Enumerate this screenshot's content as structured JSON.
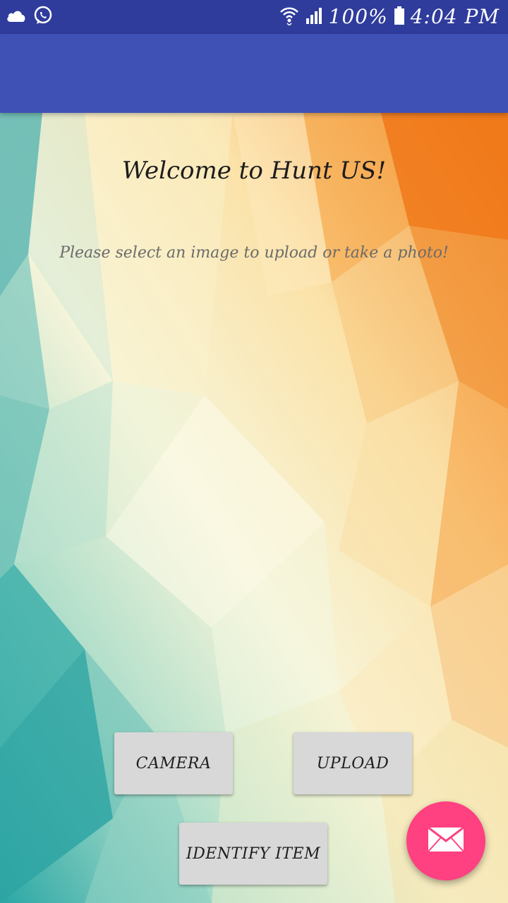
{
  "status_bar": {
    "left_icons": [
      "cloud-icon",
      "whatsapp-icon"
    ],
    "right_icons": [
      "wifi-icon",
      "signal-icon",
      "battery-icon"
    ],
    "battery": "100%",
    "time": "4:04 PM"
  },
  "app_bar": {
    "title": ""
  },
  "main": {
    "title": "Welcome to Hunt US!",
    "subtitle": "Please select an image to upload or take a photo!"
  },
  "buttons": {
    "camera": "CAMERA",
    "upload": "UPLOAD",
    "identify": "IDENTIFY ITEM"
  },
  "fab": {
    "icon": "mail-icon"
  },
  "colors": {
    "status_bar": "#2f3c9c",
    "app_bar": "#3f51b5",
    "fab": "#ff4081",
    "button": "#d8d8d8"
  }
}
